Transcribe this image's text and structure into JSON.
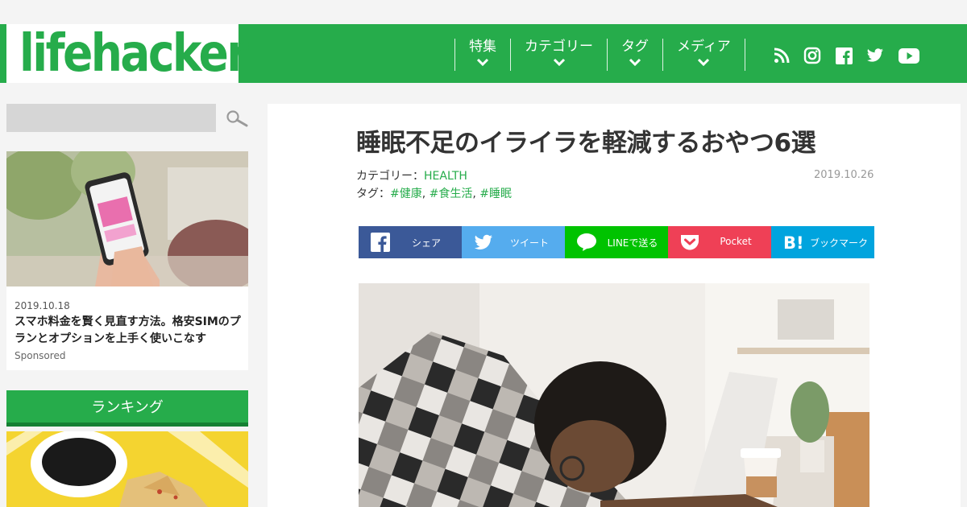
{
  "site": {
    "logo": "lifehacker",
    "brand_color": "#26ac4b"
  },
  "nav": {
    "items": [
      {
        "label": "特集"
      },
      {
        "label": "カテゴリー"
      },
      {
        "label": "タグ"
      },
      {
        "label": "メディア"
      }
    ],
    "social_icons": [
      "rss-icon",
      "instagram-icon",
      "facebook-icon",
      "twitter-icon",
      "youtube-icon"
    ]
  },
  "sidebar": {
    "search": {
      "placeholder": ""
    },
    "promo": {
      "date": "2019.10.18",
      "title": "スマホ料金を賢く見直す方法。格安SIMのプランとオプションを上手く使いこなす",
      "sponsor": "Sponsored"
    },
    "ranking": {
      "title": "ランキング"
    }
  },
  "article": {
    "title": "睡眠不足のイライラを軽減するおやつ6選",
    "category_label": "カテゴリー：",
    "category": "HEALTH",
    "tags_label": "タグ：",
    "tags": [
      "#健康",
      "#食生活",
      "#睡眠"
    ],
    "date": "2019.10.26"
  },
  "share": {
    "buttons": [
      {
        "label": "シェア",
        "color": "#3b5998",
        "icon": "facebook-icon"
      },
      {
        "label": "ツイート",
        "color": "#55acee",
        "icon": "twitter-icon"
      },
      {
        "label": "LINEで送る",
        "color": "#00c300",
        "icon": "line-icon"
      },
      {
        "label": "Pocket",
        "color": "#ef4056",
        "icon": "pocket-icon"
      },
      {
        "label": "ブックマーク",
        "color": "#00a4de",
        "icon": "hatena-bookmark-icon"
      }
    ]
  }
}
